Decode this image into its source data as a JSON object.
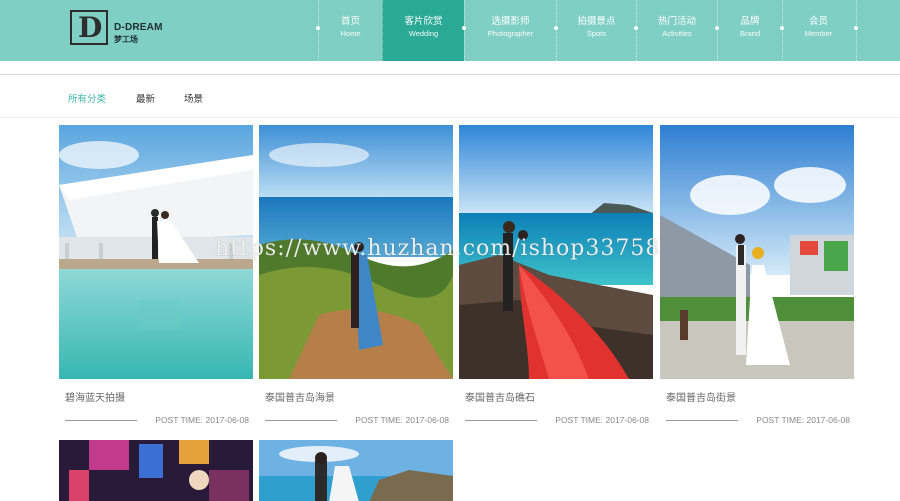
{
  "brand": {
    "logo_letter": "D",
    "name_en": "D-DREAM",
    "name_cn": "梦工场"
  },
  "nav": [
    {
      "cn": "首页",
      "en": "Home",
      "active": false
    },
    {
      "cn": "客片欣赏",
      "en": "Wedding",
      "active": true
    },
    {
      "cn": "选摄影师",
      "en": "Photographer",
      "active": false
    },
    {
      "cn": "拍摄景点",
      "en": "Spots",
      "active": false
    },
    {
      "cn": "热门活动",
      "en": "Activities",
      "active": false
    },
    {
      "cn": "品牌",
      "en": "Brand",
      "active": false
    },
    {
      "cn": "会员",
      "en": "Member",
      "active": false
    }
  ],
  "filters": [
    {
      "label": "所有分类",
      "active": true
    },
    {
      "label": "最新",
      "active": false
    },
    {
      "label": "场景",
      "active": false
    }
  ],
  "gallery": [
    {
      "title": "碧海蓝天拍摄",
      "post_time": "POST TIME: 2017-06-08"
    },
    {
      "title": "泰国普吉岛海景",
      "post_time": "POST TIME: 2017-06-08"
    },
    {
      "title": "泰国普吉岛礁石",
      "post_time": "POST TIME: 2017-06-08"
    },
    {
      "title": "泰国普吉岛街景",
      "post_time": "POST TIME: 2017-06-08"
    }
  ],
  "watermark": "https://www.huzhan.com/ishop33758",
  "colors": {
    "header_bg": "#7fcfc4",
    "nav_active_bg": "#2aa997",
    "filter_active": "#3fb5a6"
  }
}
